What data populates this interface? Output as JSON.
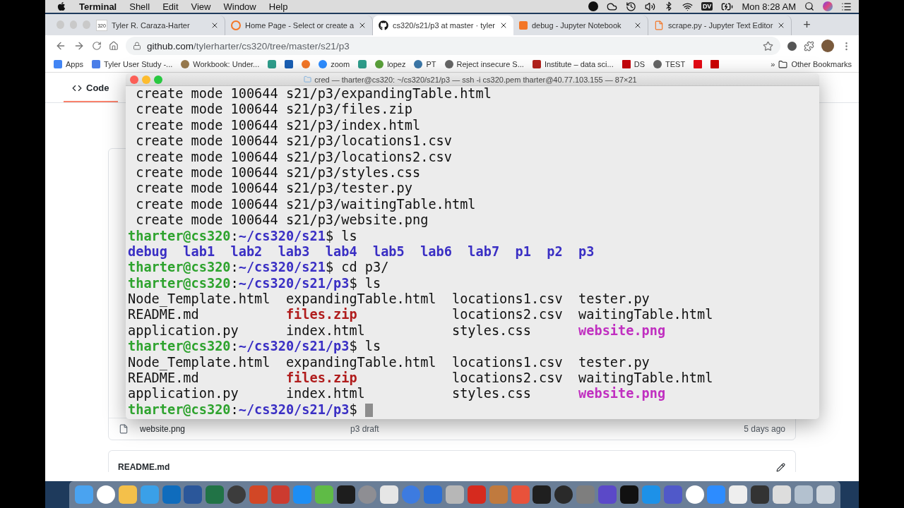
{
  "menu_bar": {
    "app": "Terminal",
    "menus": [
      "Shell",
      "Edit",
      "View",
      "Window",
      "Help"
    ],
    "badge": "DV",
    "clock": "Mon 8:28 AM"
  },
  "browser": {
    "tabs": [
      {
        "favicon": "320",
        "title": "Tyler R. Caraza-Harter",
        "selected": false
      },
      {
        "title": "Home Page - Select or create a",
        "selected": false
      },
      {
        "title": "cs320/s21/p3 at master · tyler",
        "selected": true
      },
      {
        "title": "debug - Jupyter Notebook",
        "selected": false
      },
      {
        "title": "scrape.py - Jupyter Text Editor",
        "selected": false
      }
    ],
    "new_tab": "+",
    "url_host": "github.com",
    "url_path": "/tylerharter/cs320/tree/master/s21/p3",
    "bookmarks": [
      {
        "label": "Apps"
      },
      {
        "label": "Tyler User Study -..."
      },
      {
        "label": "Workbook: Under..."
      },
      {
        "label": "zoom"
      },
      {
        "label": "lopez"
      },
      {
        "label": "PT"
      },
      {
        "label": "Reject insecure S..."
      },
      {
        "label": "Institute – data sci..."
      },
      {
        "label": "DS"
      },
      {
        "label": "TEST"
      }
    ],
    "more": "»",
    "other": "Other Bookmarks"
  },
  "page": {
    "nav_tab": "Code",
    "files": [
      {
        "name": "website.png",
        "message": "p3 draft",
        "age": "5 days ago"
      }
    ],
    "readme": "README.md"
  },
  "terminal": {
    "title": "cred — tharter@cs320: ~/cs320/s21/p3 — ssh -i cs320.pem tharter@40.77.103.155 — 87×21",
    "lines": [
      {
        "kind": "output",
        "text": "create mode 100644 s21/p3/expandingTable.html"
      },
      {
        "kind": "output",
        "text": "create mode 100644 s21/p3/files.zip"
      },
      {
        "kind": "output",
        "text": "create mode 100644 s21/p3/index.html"
      },
      {
        "kind": "output",
        "text": "create mode 100644 s21/p3/locations1.csv"
      },
      {
        "kind": "output",
        "text": "create mode 100644 s21/p3/locations2.csv"
      },
      {
        "kind": "output",
        "text": "create mode 100644 s21/p3/styles.css"
      },
      {
        "kind": "output",
        "text": "create mode 100644 s21/p3/tester.py"
      },
      {
        "kind": "output",
        "text": "create mode 100644 s21/p3/waitingTable.html"
      },
      {
        "kind": "output",
        "text": "create mode 100644 s21/p3/website.png"
      },
      {
        "kind": "prompt",
        "user": "tharter@cs320",
        "sep": ":",
        "path": "~/cs320/s21",
        "command": "$ ls",
        "cursor": false
      },
      {
        "kind": "columns",
        "entries": [
          {
            "name": "debug",
            "kind": "dir"
          },
          {
            "name": "lab1",
            "kind": "dir"
          },
          {
            "name": "lab2",
            "kind": "dir"
          },
          {
            "name": "lab3",
            "kind": "dir"
          },
          {
            "name": "lab4",
            "kind": "dir"
          },
          {
            "name": "lab5",
            "kind": "dir"
          },
          {
            "name": "lab6",
            "kind": "dir"
          },
          {
            "name": "lab7",
            "kind": "dir"
          },
          {
            "name": "p1",
            "kind": "dir"
          },
          {
            "name": "p2",
            "kind": "dir"
          },
          {
            "name": "p3",
            "kind": "dir"
          }
        ]
      },
      {
        "kind": "prompt",
        "user": "tharter@cs320",
        "sep": ":",
        "path": "~/cs320/s21",
        "command": "$ cd p3/",
        "cursor": false
      },
      {
        "kind": "prompt",
        "user": "tharter@cs320",
        "sep": ":",
        "path": "~/cs320/s21/p3",
        "command": "$ ls",
        "cursor": false
      },
      {
        "kind": "listing",
        "entries": [
          {
            "name": "Node_Template.html",
            "kind": "file"
          },
          {
            "name": "expandingTable.html",
            "kind": "file"
          },
          {
            "name": "locations1.csv",
            "kind": "file"
          },
          {
            "name": "tester.py",
            "kind": "file"
          }
        ]
      },
      {
        "kind": "listing",
        "entries": [
          {
            "name": "README.md",
            "kind": "file"
          },
          {
            "name": "files.zip",
            "kind": "archive"
          },
          {
            "name": "locations2.csv",
            "kind": "file"
          },
          {
            "name": "waitingTable.html",
            "kind": "file"
          }
        ]
      },
      {
        "kind": "listing",
        "entries": [
          {
            "name": "application.py",
            "kind": "file"
          },
          {
            "name": "index.html",
            "kind": "file"
          },
          {
            "name": "styles.css",
            "kind": "file"
          },
          {
            "name": "website.png",
            "kind": "image"
          }
        ]
      },
      {
        "kind": "prompt",
        "user": "tharter@cs320",
        "sep": ":",
        "path": "~/cs320/s21/p3",
        "command": "$ ls",
        "cursor": false
      },
      {
        "kind": "listing",
        "entries": [
          {
            "name": "Node_Template.html",
            "kind": "file"
          },
          {
            "name": "expandingTable.html",
            "kind": "file"
          },
          {
            "name": "locations1.csv",
            "kind": "file"
          },
          {
            "name": "tester.py",
            "kind": "file"
          }
        ]
      },
      {
        "kind": "listing",
        "entries": [
          {
            "name": "README.md",
            "kind": "file"
          },
          {
            "name": "files.zip",
            "kind": "archive"
          },
          {
            "name": "locations2.csv",
            "kind": "file"
          },
          {
            "name": "waitingTable.html",
            "kind": "file"
          }
        ]
      },
      {
        "kind": "listing",
        "entries": [
          {
            "name": "application.py",
            "kind": "file"
          },
          {
            "name": "index.html",
            "kind": "file"
          },
          {
            "name": "styles.css",
            "kind": "file"
          },
          {
            "name": "website.png",
            "kind": "image"
          }
        ]
      },
      {
        "kind": "prompt",
        "user": "tharter@cs320",
        "sep": ":",
        "path": "~/cs320/s21/p3",
        "command": "$",
        "cursor": true
      }
    ]
  }
}
